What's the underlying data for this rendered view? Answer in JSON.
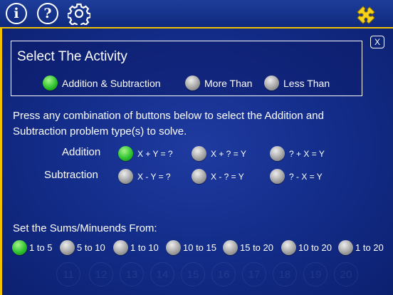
{
  "toolbar": {
    "info_label": "i",
    "help_label": "?",
    "close_label": "X"
  },
  "activity": {
    "title": "Select The Activity",
    "options": [
      {
        "label": "Addition & Subtraction",
        "selected": true
      },
      {
        "label": "More Than",
        "selected": false
      },
      {
        "label": "Less Than",
        "selected": false
      }
    ]
  },
  "instructions": "Press any combination of buttons below to select the Addition and Subtraction problem type(s) to solve.",
  "problem_types": {
    "addition": {
      "label": "Addition",
      "options": [
        {
          "label": "X + Y = ?",
          "selected": true
        },
        {
          "label": "X + ? = Y",
          "selected": false
        },
        {
          "label": "? + X = Y",
          "selected": false
        }
      ]
    },
    "subtraction": {
      "label": "Subtraction",
      "options": [
        {
          "label": "X - Y = ?",
          "selected": false
        },
        {
          "label": "X - ? = Y",
          "selected": false
        },
        {
          "label": "? - X = Y",
          "selected": false
        }
      ]
    }
  },
  "sums": {
    "label": "Set the Sums/Minuends From:",
    "options": [
      {
        "label": "1 to 5",
        "selected": true
      },
      {
        "label": "5 to 10",
        "selected": false
      },
      {
        "label": "1 to 10",
        "selected": false
      },
      {
        "label": "10 to 15",
        "selected": false
      },
      {
        "label": "15 to 20",
        "selected": false
      },
      {
        "label": "10 to 20",
        "selected": false
      },
      {
        "label": "1 to 20",
        "selected": false
      }
    ]
  },
  "background_numbers": [
    "11",
    "12",
    "13",
    "14",
    "15",
    "16",
    "17",
    "18",
    "19",
    "20"
  ],
  "colors": {
    "accent": "#f2c200",
    "background": "#142e8c",
    "selected": "#2fc32f",
    "unselected": "#a4a4a4"
  },
  "icons": {
    "info": "info-icon",
    "help": "help-icon",
    "settings": "gear-icon",
    "puzzle": "puzzle-icon",
    "close": "close-icon"
  }
}
